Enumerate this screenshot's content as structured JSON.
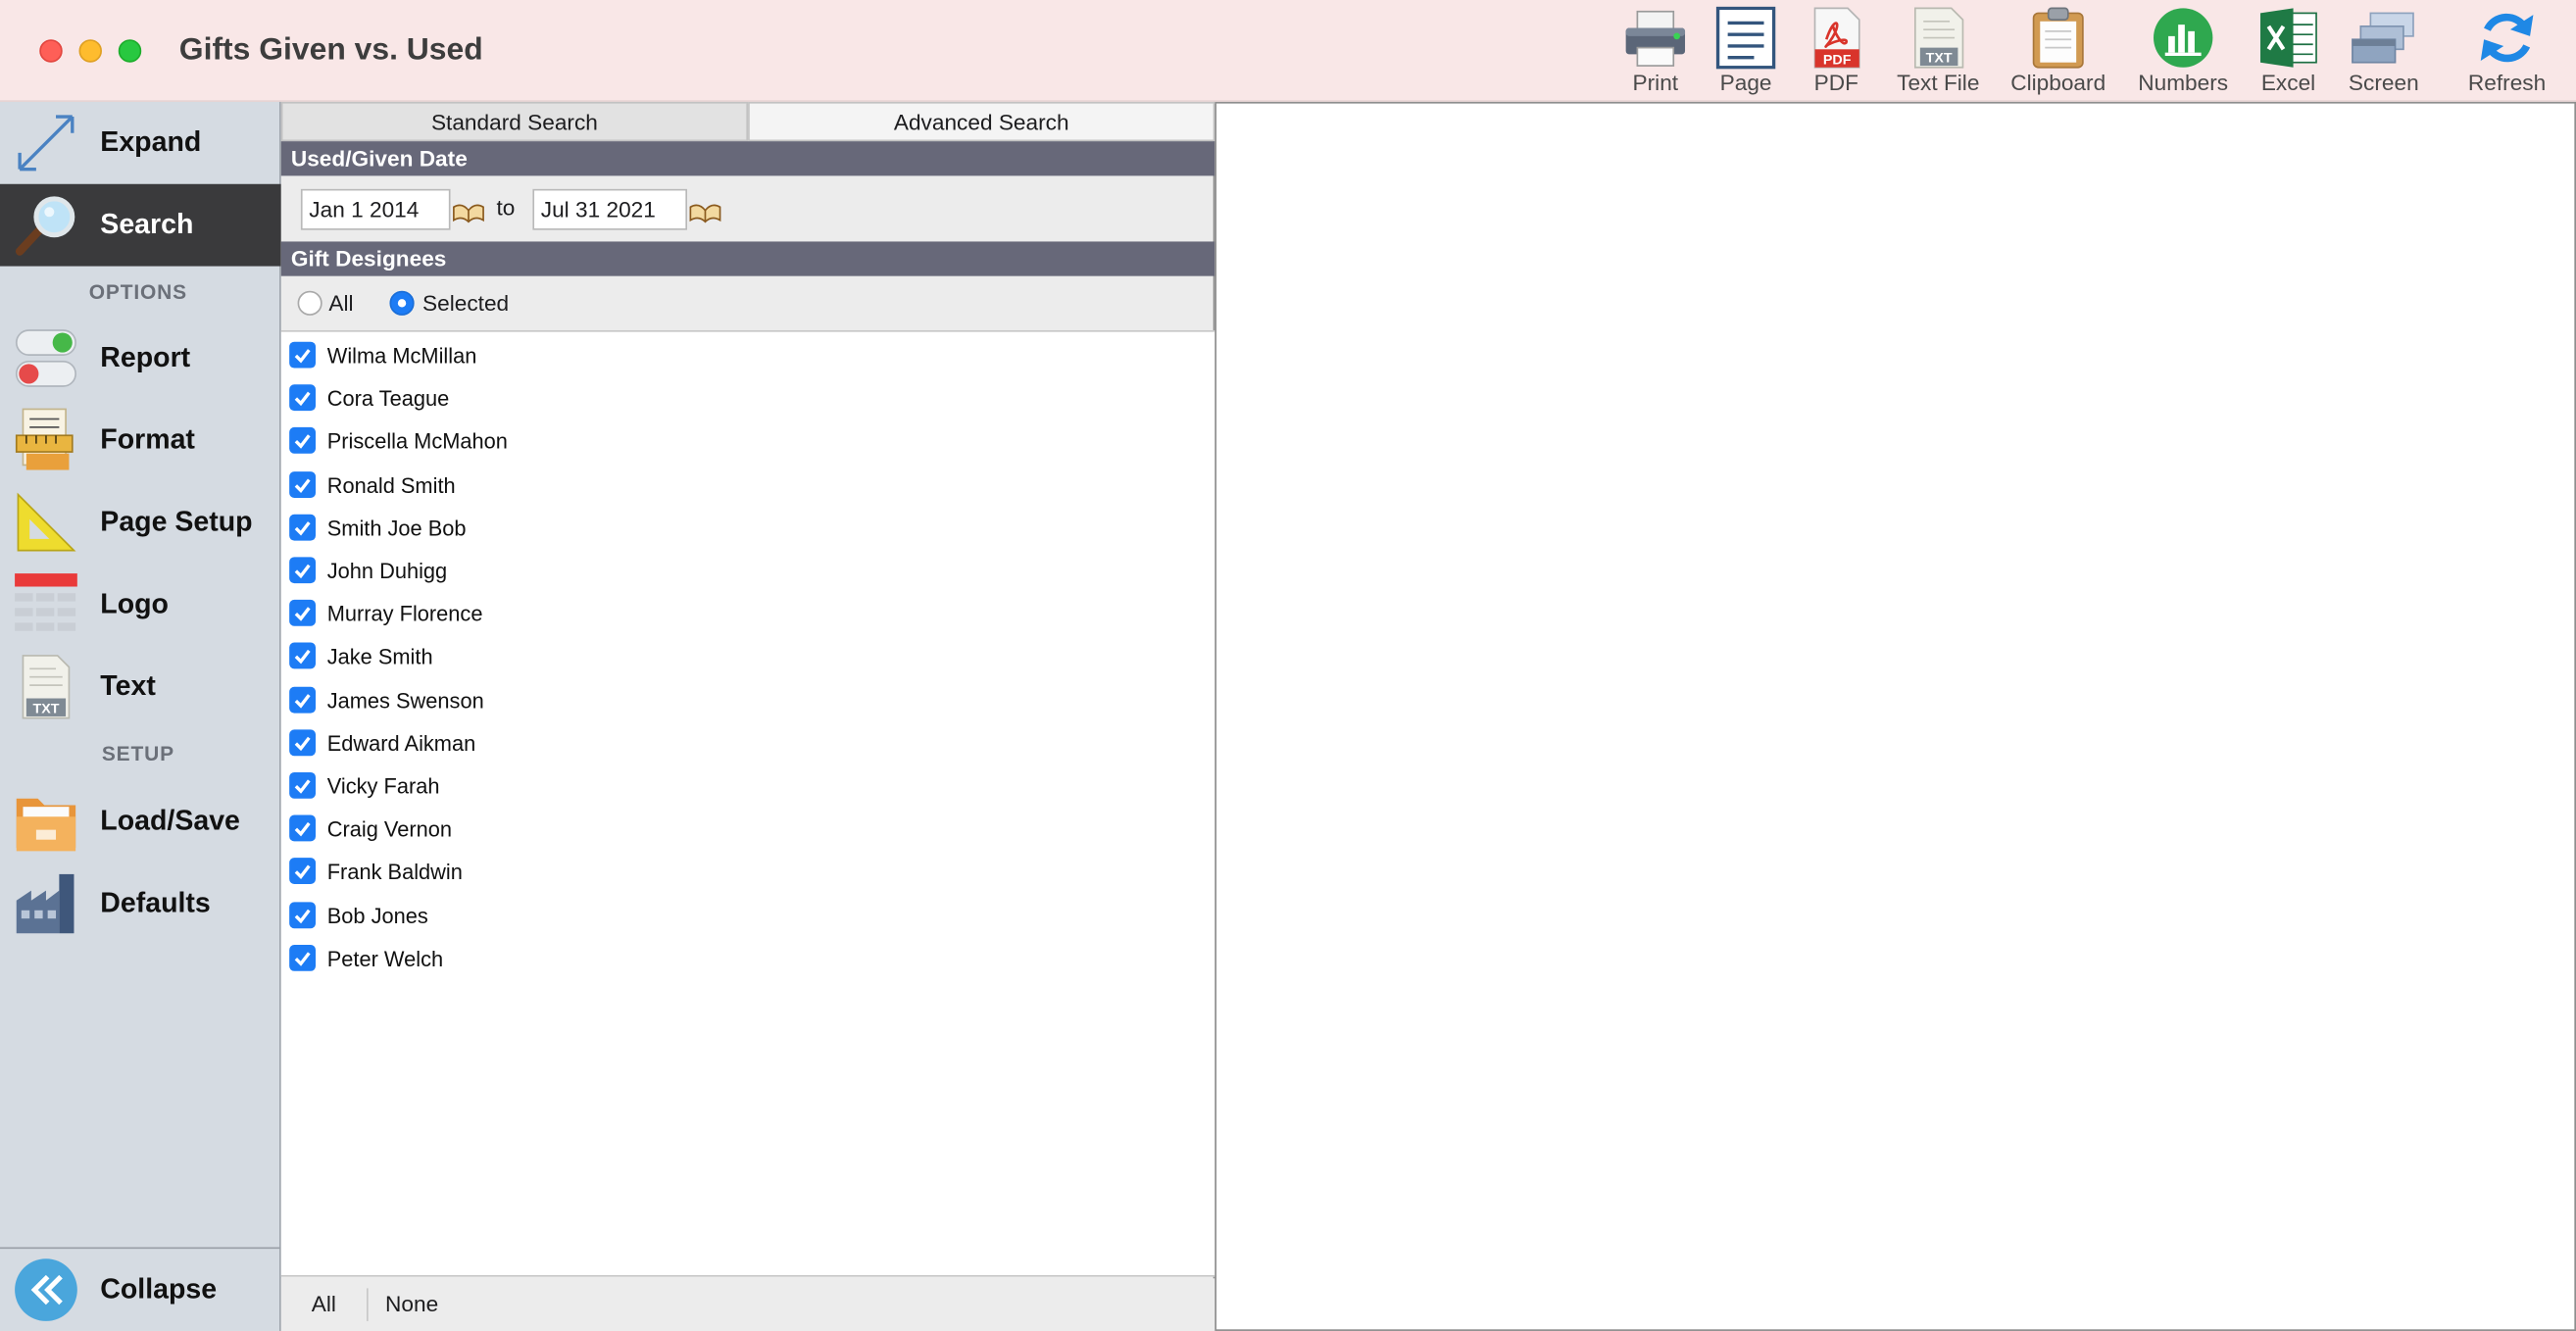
{
  "window": {
    "title": "Gifts Given vs. Used"
  },
  "toolbar": {
    "print": "Print",
    "page": "Page",
    "pdf": "PDF",
    "text_file": "Text File",
    "clipboard": "Clipboard",
    "numbers": "Numbers",
    "excel": "Excel",
    "screen": "Screen",
    "refresh": "Refresh",
    "pdf_badge": "PDF",
    "txt_badge": "TXT"
  },
  "sidebar": {
    "expand": "Expand",
    "search": "Search",
    "options_header": "OPTIONS",
    "report": "Report",
    "format": "Format",
    "page_setup": "Page Setup",
    "logo": "Logo",
    "text": "Text",
    "setup_header": "SETUP",
    "load_save": "Load/Save",
    "defaults": "Defaults",
    "collapse": "Collapse",
    "txt_badge": "TXT"
  },
  "search": {
    "tabs": [
      "Standard Search",
      "Advanced Search"
    ],
    "date_section": "Used/Given Date",
    "date_from": "Jan 1 2014",
    "date_to_label": "to",
    "date_to": "Jul 31 2021",
    "designees_section": "Gift Designees",
    "radio_all": "All",
    "radio_selected": "Selected",
    "selected_radio": "Selected",
    "designees": [
      "Wilma McMillan",
      "Cora Teague",
      "Priscella McMahon",
      "Ronald Smith",
      "Smith Joe Bob",
      "John Duhigg",
      "Murray Florence",
      "Jake Smith",
      "James Swenson",
      "Edward Aikman",
      "Vicky Farah",
      "Craig Vernon",
      "Frank Baldwin",
      "Bob Jones",
      "Peter Welch"
    ],
    "all_checked": true,
    "select_all_button": "All",
    "select_none_button": "None"
  },
  "colors": {
    "titlebar": "#f9e7e7",
    "sidebar": "#d5dbe2",
    "active_item": "#3a3a3c",
    "section_header": "#676879",
    "accent": "#1d7cf5"
  }
}
